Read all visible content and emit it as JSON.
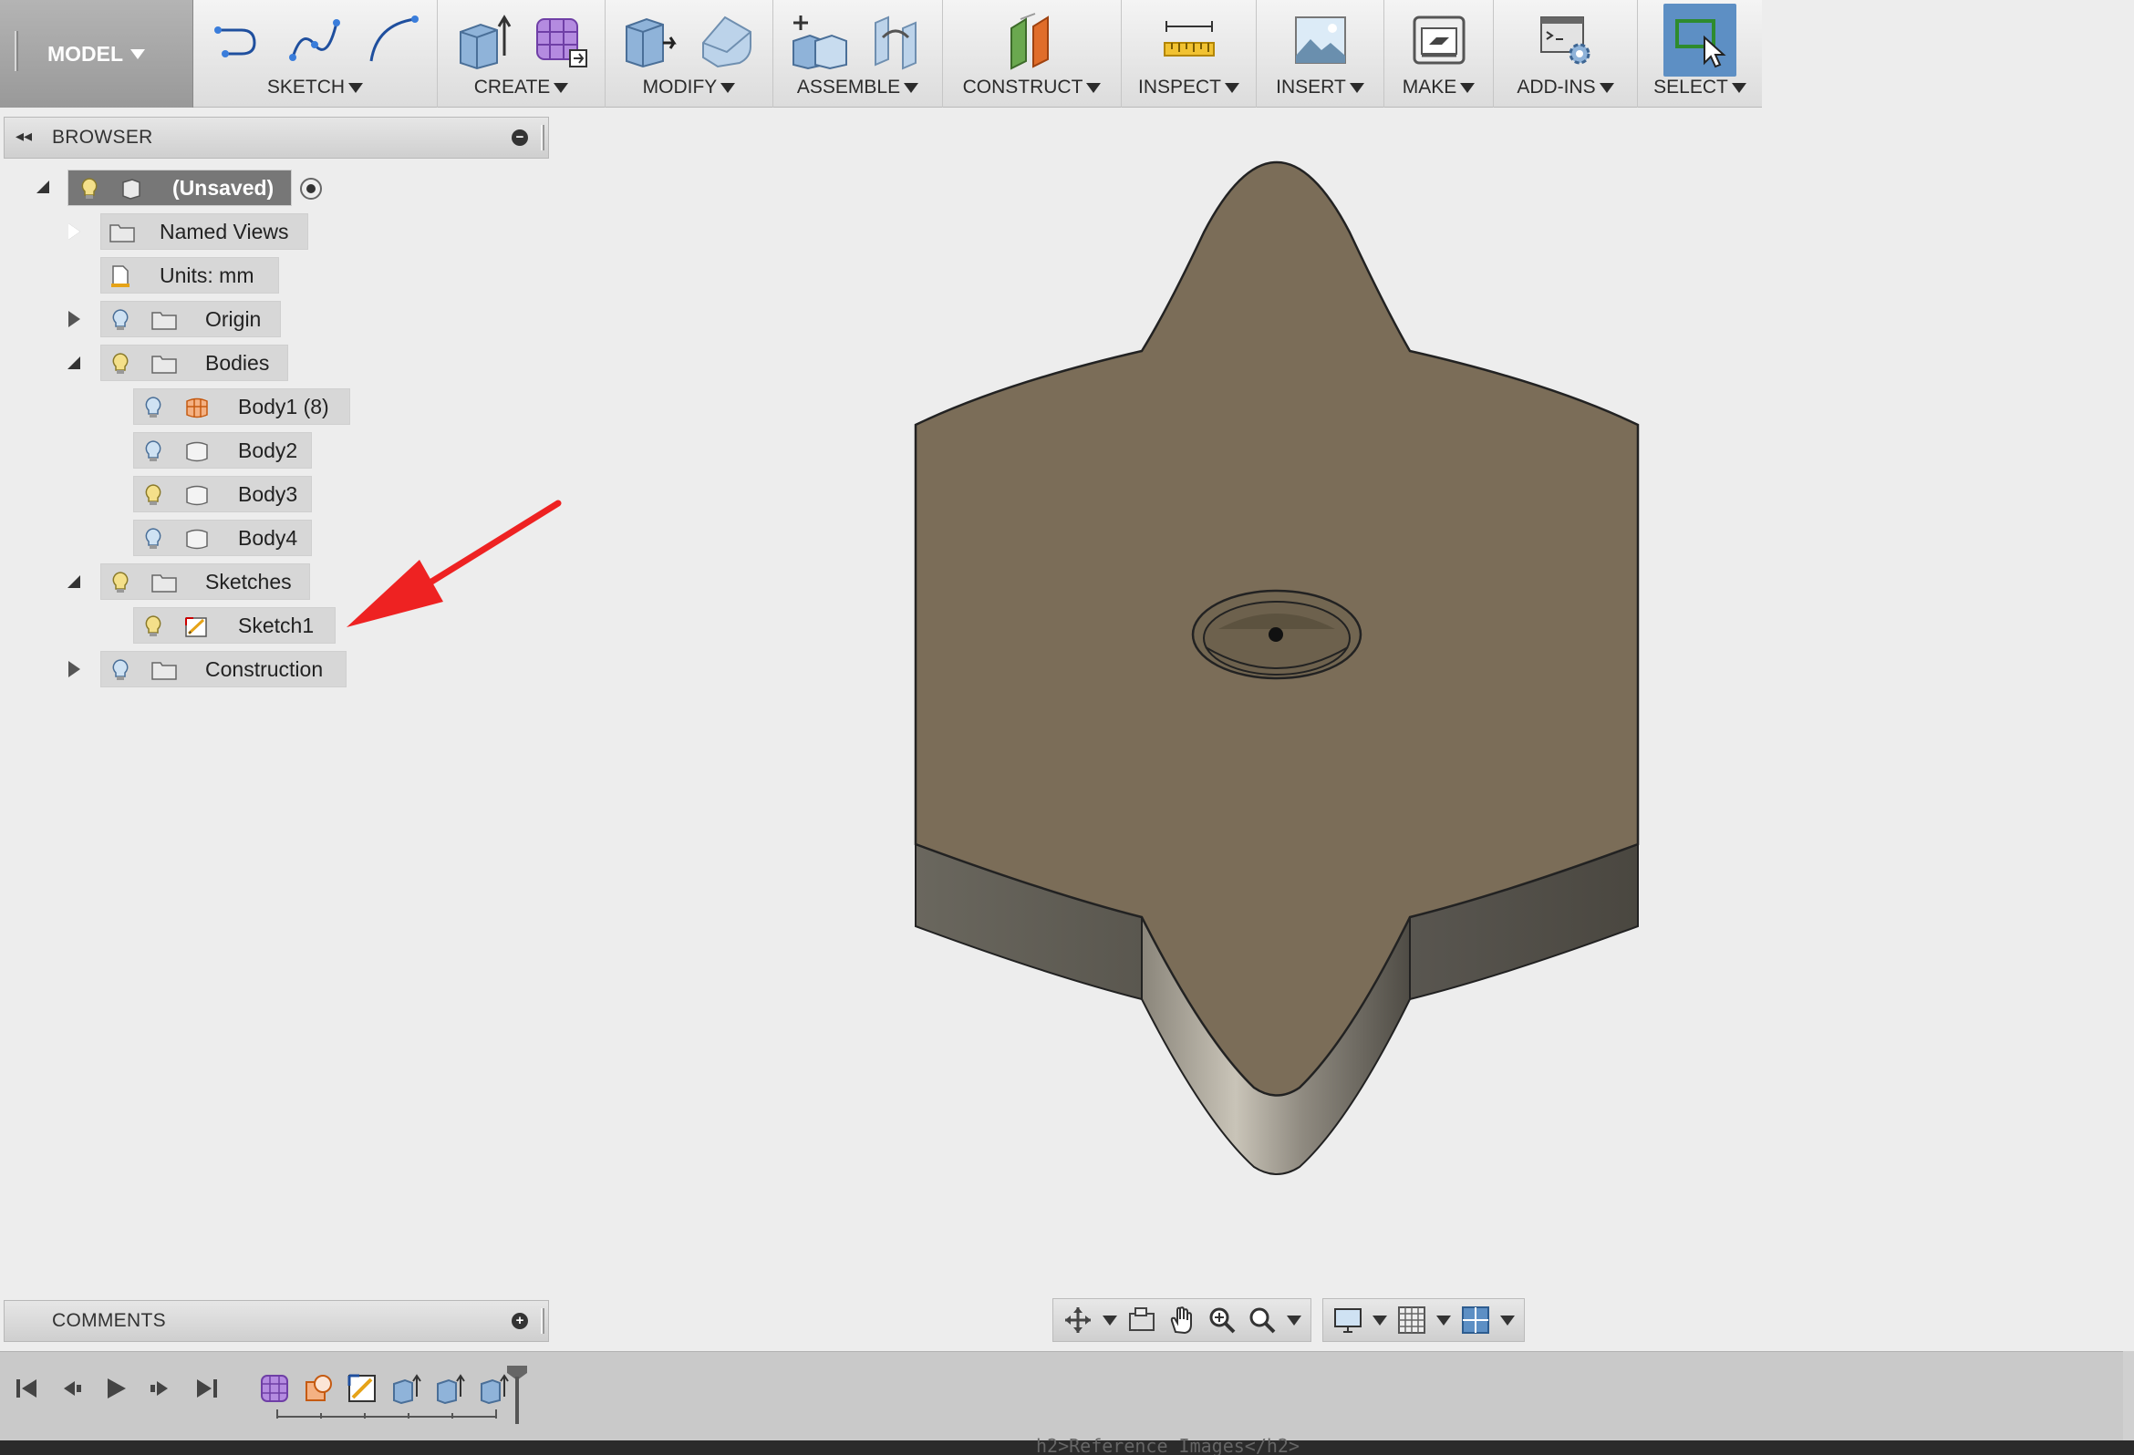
{
  "toolbar": {
    "workspace": "MODEL",
    "groups": [
      {
        "label": "SKETCH"
      },
      {
        "label": "CREATE"
      },
      {
        "label": "MODIFY"
      },
      {
        "label": "ASSEMBLE"
      },
      {
        "label": "CONSTRUCT"
      },
      {
        "label": "INSPECT"
      },
      {
        "label": "INSERT"
      },
      {
        "label": "MAKE"
      },
      {
        "label": "ADD-INS"
      },
      {
        "label": "SELECT"
      }
    ]
  },
  "browser": {
    "title": "BROWSER",
    "root": "(Unsaved)",
    "items": [
      {
        "label": "Named Views"
      },
      {
        "label": "Units: mm"
      },
      {
        "label": "Origin"
      },
      {
        "label": "Bodies"
      },
      {
        "label": "Body1 (8)"
      },
      {
        "label": "Body2"
      },
      {
        "label": "Body3"
      },
      {
        "label": "Body4"
      },
      {
        "label": "Sketches"
      },
      {
        "label": "Sketch1"
      },
      {
        "label": "Construction"
      }
    ]
  },
  "comments": {
    "title": "COMMENTS"
  },
  "bottom_strip_text": "h2>Reference Images</h2>",
  "colors": {
    "model_top": "#7b6d58",
    "model_side": "#5e5a51",
    "annotation_arrow": "#ee2222",
    "select_active": "#5d8fc4"
  }
}
